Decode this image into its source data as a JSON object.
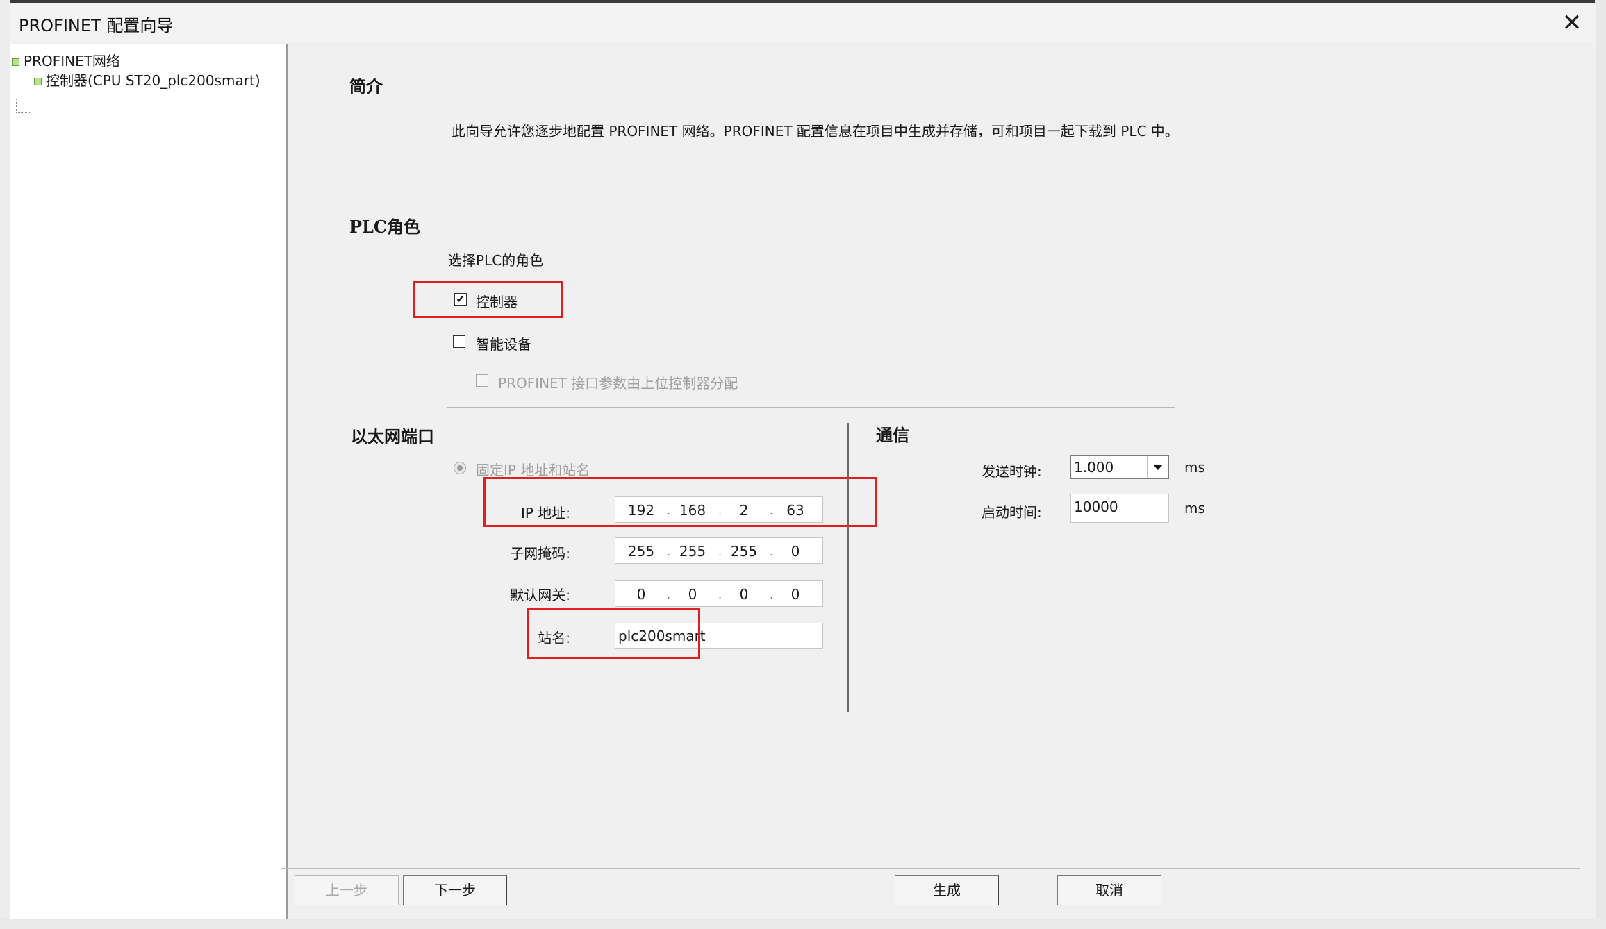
{
  "dialog": {
    "title": "PROFINET 配置向导",
    "close_symbol": "✕"
  },
  "tree": {
    "root_label": "PROFINET网络",
    "child_label": "控制器(CPU ST20_plc200smart)"
  },
  "intro": {
    "title": "简介",
    "text": "此向导允许您逐步地配置 PROFINET 网络。PROFINET 配置信息在项目中生成并存储，可和项目一起下载到 PLC 中。"
  },
  "plc_role": {
    "title": "PLC角色",
    "prompt": "选择PLC的角色",
    "controller_label": "控制器",
    "controller_checked": true,
    "smart_device_label": "智能设备",
    "smart_device_checked": false,
    "param_assign_label": "PROFINET 接口参数由上位控制器分配",
    "param_assign_checked": false,
    "check_mark": "✔"
  },
  "ethernet": {
    "title": "以太网端口",
    "fixed_ip_label": "固定IP 地址和站名",
    "ip_label": "IP 地址:",
    "ip": [
      "192",
      "168",
      "2",
      "63"
    ],
    "subnet_label": "子网掩码:",
    "subnet": [
      "255",
      "255",
      "255",
      "0"
    ],
    "gateway_label": "默认网关:",
    "gateway": [
      "0",
      "0",
      "0",
      "0"
    ],
    "station_label": "站名:",
    "station_value": "plc200smart",
    "dot": "."
  },
  "comm": {
    "title": "通信",
    "send_clock_label": "发送时钟:",
    "send_clock_value": "1.000",
    "send_clock_unit": "ms",
    "startup_label": "启动时间:",
    "startup_value": "10000",
    "startup_unit": "ms"
  },
  "buttons": {
    "prev": "上一步",
    "next": "下一步",
    "generate": "生成",
    "cancel": "取消"
  },
  "colors": {
    "highlight": "#e02020",
    "tree_node_icon": "#b9e08c"
  }
}
